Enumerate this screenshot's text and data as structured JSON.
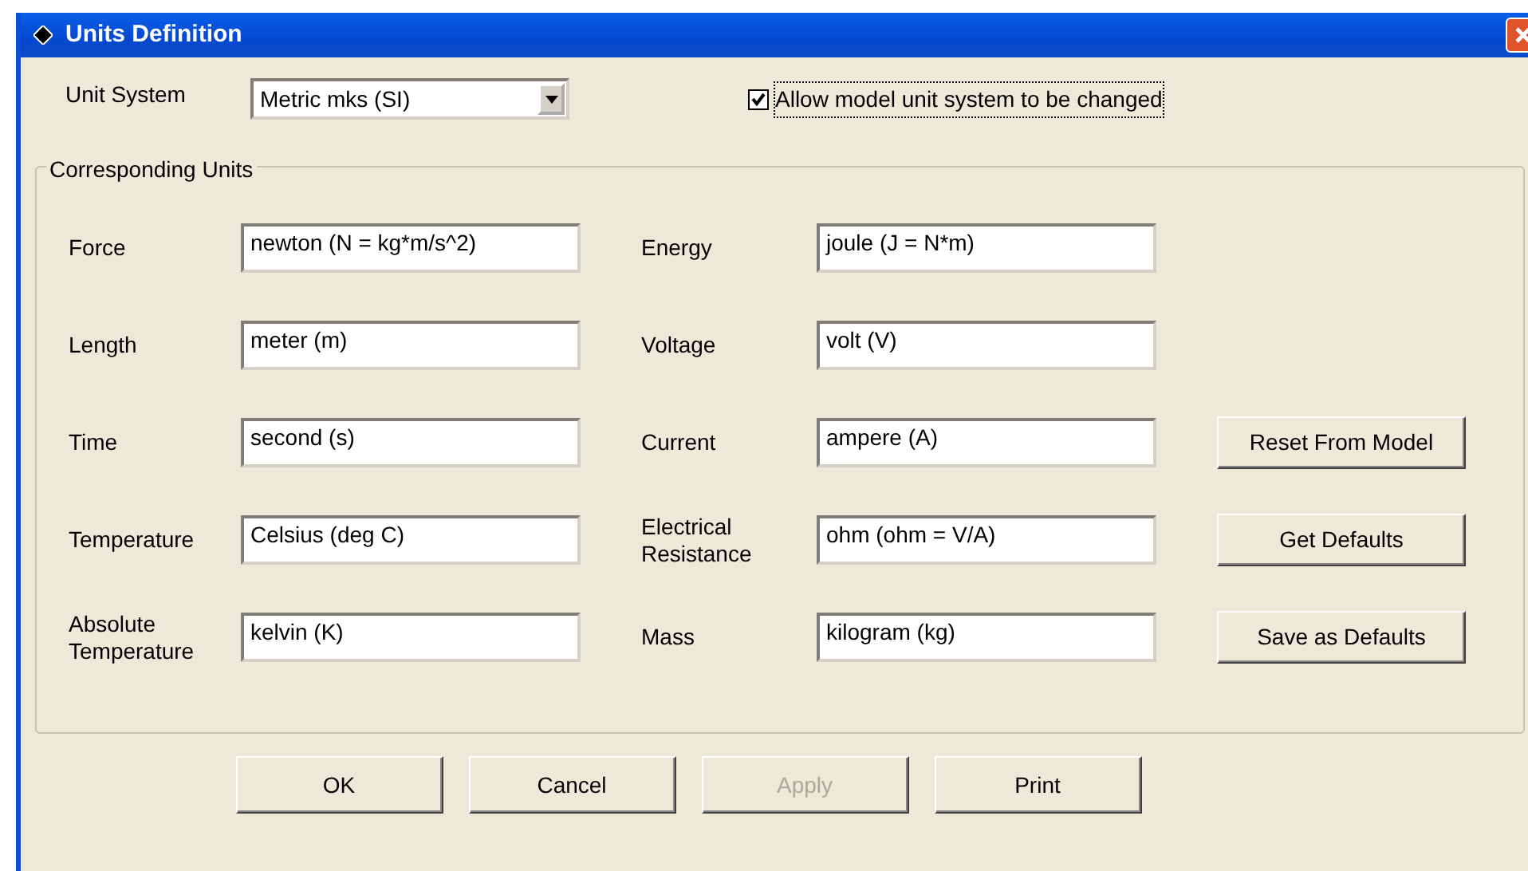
{
  "window": {
    "title": "Units Definition"
  },
  "unit_system": {
    "label": "Unit System",
    "value": "Metric mks (SI)"
  },
  "allow_change": {
    "label": "Allow model unit system to be changed",
    "checked": true
  },
  "group": {
    "title": "Corresponding Units",
    "rows": [
      {
        "left": {
          "label": "Force",
          "value": "newton (N = kg*m/s^2)"
        },
        "right": {
          "label": "Energy",
          "value": "joule (J = N*m)"
        }
      },
      {
        "left": {
          "label": "Length",
          "value": "meter (m)"
        },
        "right": {
          "label": "Voltage",
          "value": "volt (V)"
        }
      },
      {
        "left": {
          "label": "Time",
          "value": "second (s)"
        },
        "right": {
          "label": "Current",
          "value": "ampere (A)"
        },
        "action": {
          "label": "Reset From Model"
        }
      },
      {
        "left": {
          "label": "Temperature",
          "value": "Celsius (deg C)"
        },
        "right": {
          "label": "Electrical Resistance",
          "value": "ohm (ohm = V/A)"
        },
        "action": {
          "label": "Get Defaults"
        }
      },
      {
        "left": {
          "label": "Absolute Temperature",
          "value": "kelvin (K)"
        },
        "right": {
          "label": "Mass",
          "value": "kilogram (kg)"
        },
        "action": {
          "label": "Save as Defaults"
        }
      }
    ]
  },
  "buttons": [
    {
      "label": "OK",
      "disabled": false
    },
    {
      "label": "Cancel",
      "disabled": false
    },
    {
      "label": "Apply",
      "disabled": true
    },
    {
      "label": "Print",
      "disabled": false
    }
  ]
}
